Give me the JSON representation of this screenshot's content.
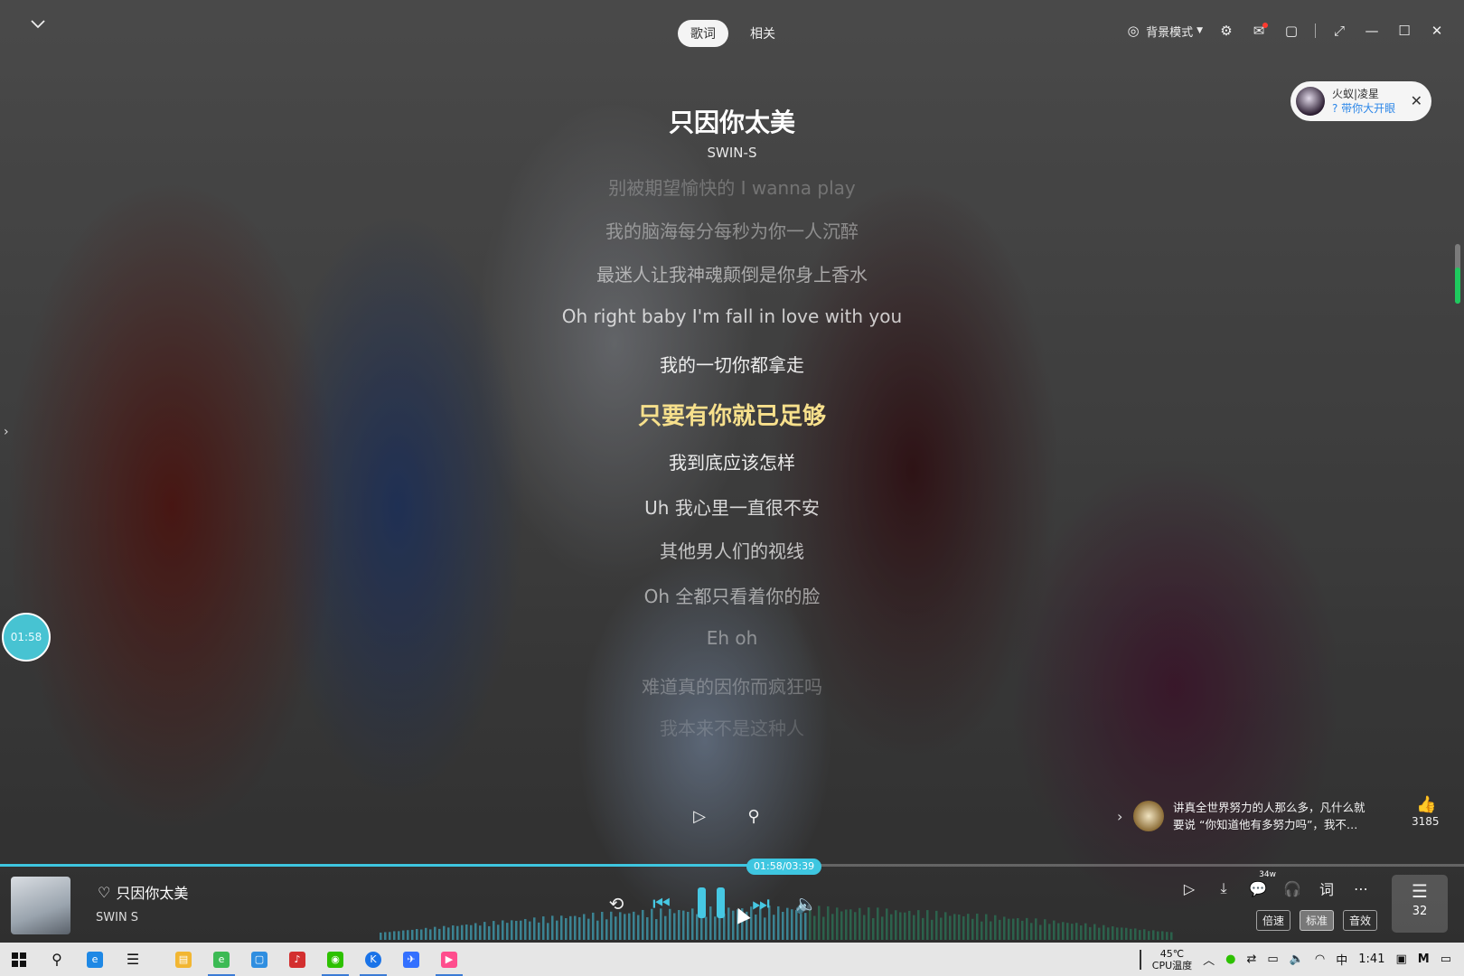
{
  "header": {
    "tabs": [
      {
        "label": "歌词",
        "active": true
      },
      {
        "label": "相关",
        "active": false
      }
    ],
    "bg_mode_label": "背景模式",
    "icons": [
      "settings-icon",
      "mail-icon",
      "mini-mode-icon",
      "fullscreen-icon",
      "minimize-icon",
      "maximize-icon",
      "close-icon"
    ]
  },
  "notification": {
    "title": "火蚁|凌星",
    "subtitle": "? 带你大开眼"
  },
  "song": {
    "title": "只因你太美",
    "artist": "SWIN-S"
  },
  "lyrics": [
    {
      "text": "别被期望愉快的 I wanna play",
      "opacity": 0.25
    },
    {
      "text": "我的脑海每分每秒为你一人沉醉",
      "opacity": 0.4
    },
    {
      "text": "最迷人让我神魂颠倒是你身上香水",
      "opacity": 0.55
    },
    {
      "text": "Oh right baby I'm fall in love with you",
      "opacity": 0.75
    },
    {
      "text": "我的一切你都拿走",
      "opacity": 0.9
    },
    {
      "text": "只要有你就已足够",
      "opacity": 1,
      "current": true
    },
    {
      "text": "我到底应该怎样",
      "opacity": 0.9
    },
    {
      "text": "Uh 我心里一直很不安",
      "opacity": 0.8
    },
    {
      "text": "其他男人们的视线",
      "opacity": 0.7
    },
    {
      "text": "Oh 全都只看着你的脸",
      "opacity": 0.55
    },
    {
      "text": "Eh oh",
      "opacity": 0.4
    },
    {
      "text": "难道真的因你而疯狂吗",
      "opacity": 0.28
    },
    {
      "text": "我本来不是这种人",
      "opacity": 0.16
    }
  ],
  "playback": {
    "elapsed_bubble": "01:58",
    "time_display": "01:58/03:39",
    "progress": 0.538
  },
  "comment": {
    "text_line1": "讲真全世界努力的人那么多，凡什么就",
    "text_line2": "要说 “你知道他有多努力吗”，我不…",
    "likes": "3185"
  },
  "now_playing": {
    "title": "只因你太美",
    "artist": "SWIN S"
  },
  "right_tools": {
    "comment_count": "34w",
    "lyric_label": "词"
  },
  "quality": [
    {
      "label": "倍速",
      "active": false
    },
    {
      "label": "标准",
      "active": true
    },
    {
      "label": "音效",
      "active": false
    }
  ],
  "playlist_count": "32",
  "taskbar": {
    "temp": "45℃",
    "cpu_label": "CPU温度",
    "ime": "中",
    "clock": "1:41"
  },
  "colors": {
    "accent": "#46c8e3",
    "current_lyric": "#f7e08c",
    "scroll_green": "#1ec95e",
    "bubble": "#47c3d2"
  }
}
